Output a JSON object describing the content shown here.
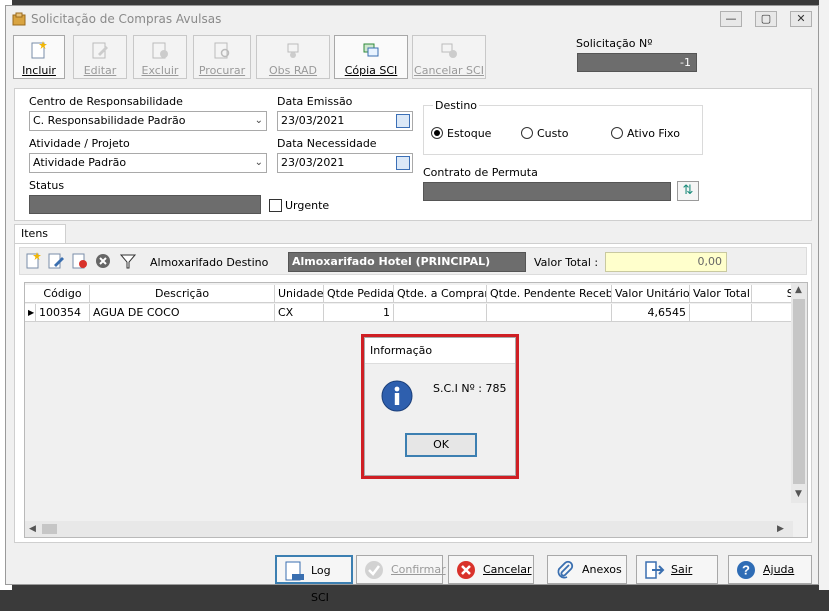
{
  "window": {
    "title": "Solicitação de Compras Avulsas",
    "minimize": "—",
    "maximize": "▢",
    "close": "✕"
  },
  "toolbar": {
    "items": [
      {
        "label": "Incluir",
        "enabled": true
      },
      {
        "label": "Editar",
        "enabled": false
      },
      {
        "label": "Excluir",
        "enabled": false
      },
      {
        "label": "Procurar",
        "enabled": false
      },
      {
        "label": "Obs RAD",
        "enabled": false
      },
      {
        "label": "Cópia SCI",
        "enabled": true
      },
      {
        "label": "Cancelar SCI",
        "enabled": false
      }
    ]
  },
  "solicitacao": {
    "label": "Solicitação Nº",
    "value": "-1"
  },
  "form": {
    "centro_label": "Centro de Responsabilidade",
    "centro_value": "C. Responsabilidade Padrão",
    "atividade_label": "Atividade / Projeto",
    "atividade_value": "Atividade Padrão",
    "status_label": "Status",
    "data_emissao_label": "Data Emissão",
    "data_emissao_value": "23/03/2021",
    "data_necessidade_label": "Data Necessidade",
    "data_necessidade_value": "23/03/2021",
    "urgente_label": "Urgente",
    "destino_label": "Destino",
    "destino_options": [
      "Estoque",
      "Custo",
      "Ativo Fixo"
    ],
    "destino_selected": "Estoque",
    "contrato_label": "Contrato de Permuta"
  },
  "tabs": {
    "itens": "Itens"
  },
  "items_toolbar": {
    "almox_label": "Almoxarifado Destino",
    "almox_value": "Almoxarifado Hotel (PRINCIPAL)",
    "valor_total_label": "Valor Total :",
    "valor_total_value": "0,00"
  },
  "grid": {
    "columns": [
      "Código",
      "Descrição",
      "Unidade",
      "Qtde Pedida",
      "Qtde. a Comprar",
      "Qtde. Pendente Receb.",
      "Valor Unitário",
      "Valor Total",
      "St"
    ],
    "rows": [
      [
        "100354",
        "AGUA DE COCO",
        "CX",
        "1",
        "",
        "",
        "4,6545",
        "",
        ""
      ]
    ]
  },
  "dialog": {
    "title": "Informação",
    "message": "S.C.I Nº : 785",
    "ok": "OK"
  },
  "bottom_buttons": [
    {
      "label": "Log SCI",
      "enabled": true
    },
    {
      "label": "Confirmar",
      "enabled": false
    },
    {
      "label": "Cancelar",
      "enabled": true
    },
    {
      "label": "Anexos",
      "enabled": true
    },
    {
      "label": "Sair",
      "enabled": true
    },
    {
      "label": "Ajuda",
      "enabled": true
    }
  ],
  "colors": {
    "accent": "#3c7fb1",
    "highlight": "#cf1f24",
    "readonly_field": "#6d6d6d",
    "total_field": "#ffffcc"
  }
}
